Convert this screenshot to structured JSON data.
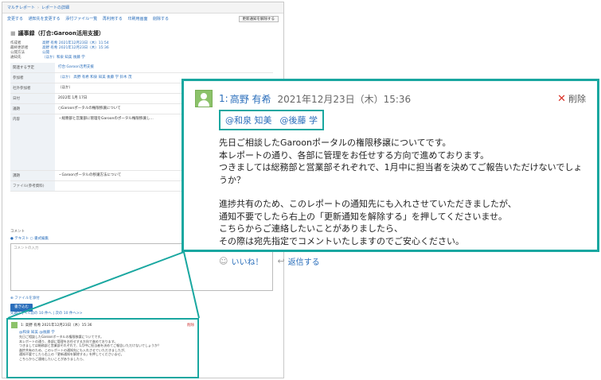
{
  "background": {
    "breadcrumb": [
      "マルチレポート",
      "レポートの詳細"
    ],
    "toolbar": {
      "items": [
        "変更する",
        "通知先を変更する",
        "添付ファイル一覧",
        "再利用する",
        "印刷用画面",
        "削除する"
      ],
      "right_button": "更新通知を解除する"
    },
    "title": "議事録（打合:Garoon活用支援）",
    "meta": [
      {
        "k": "作成者",
        "v": "高野 有希  2021年12月23日（木）11:54"
      },
      {
        "k": "最終更新者",
        "v": "高野 有希  2021年12月23日（木）15:36"
      },
      {
        "k": "公開方法",
        "v": "公開"
      },
      {
        "k": "通知先",
        "v": "（ほか）和泉 知美  後藤 学"
      }
    ],
    "form_rows": [
      {
        "label": "関連する予定",
        "value": "打合:Garoon活用支援"
      },
      {
        "label": "参加者",
        "value": "（ほか） 高野 有希  和泉 知美  後藤 学  鈴木 茂"
      },
      {
        "label": "社外参加者",
        "value": "（ほか）"
      },
      {
        "label": "日付",
        "value": "2022年 1月 17日"
      },
      {
        "label": "議題",
        "value": "○Garoonポータルの権限移譲について"
      },
      {
        "label": "内容",
        "value": "・総務部と営業部に管理をGaroonのポータル権限移譲し…"
      },
      {
        "label": "課題",
        "value": "・Garoonポータルの移譲方法について"
      },
      {
        "label": "ファイル(参考資料)",
        "value": ""
      }
    ],
    "comment_label": "コメント",
    "radio": "● テキスト  ○ 書式編集",
    "comment_placeholder": "コメントの入力",
    "attach_label": "ファイルを添付",
    "submit_label": "書き込む",
    "pager": "先頭へ | <<前の 10 件へ | 次の 10 件へ>>"
  },
  "small_comment": {
    "head": "1: 高野 有希  2021年12月23日（木）15:36",
    "delete": "削除",
    "mentions": "@和泉 知美  @後藤 学",
    "lines": [
      "先日ご相談したGaroonポータルの権限移譲についてです。",
      "本レポートの通り、各部に管理をお任せする方向で進めております。",
      "つきましては総務部と営業部それぞれで、1月中に担当者を決めてご報告いただけないでしょうか？",
      "進捗共有のため、このレポートの通知先にも入れさせていただきましたが、",
      "通知不要でしたら右上の「更新通知を解除する」を押してくださいませ。",
      "こちらからご連絡したいことがありましたら、"
    ]
  },
  "comment": {
    "number": "1:",
    "author": "高野 有希",
    "timestamp": "2021年12月23日（木）15:36",
    "delete_label": "削除",
    "mentions": [
      "@和泉 知美",
      "@後藤 学"
    ],
    "paragraph1": [
      "先日ご相談したGaroonポータルの権限移譲についてです。",
      "本レポートの通り、各部に管理をお任せする方向で進めております。",
      "つきましては総務部と営業部それぞれで、1月中に担当者を決めてご報告いただけないでしょうか？"
    ],
    "paragraph2": [
      "進捗共有のため、このレポートの通知先にも入れさせていただきましたが、",
      "通知不要でしたら右上の「更新通知を解除する」を押してくださいませ。",
      "こちらからご連絡したいことがありましたら、",
      "その際は宛先指定でコメントいたしますのでご安心ください。"
    ],
    "like_label": "いいね！",
    "reply_label": "返信する"
  },
  "colors": {
    "highlight": "#19a7a0",
    "link": "#2a6ebb",
    "delete": "#d93025",
    "avatar": "#8cc26a"
  }
}
